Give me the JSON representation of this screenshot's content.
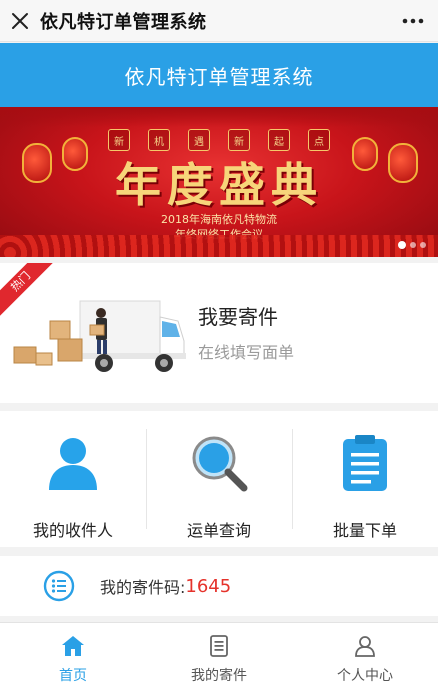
{
  "window": {
    "title": "依凡特订单管理系统",
    "close_icon": "close-icon",
    "more_icon": "more-icon"
  },
  "header": {
    "title": "依凡特订单管理系统",
    "color": "#2aa0e6"
  },
  "banner": {
    "chips": [
      "新",
      "机",
      "遇",
      "新",
      "起",
      "点"
    ],
    "main_text": "年度盛典",
    "subtitle_line1": "2018年海南依凡特物流",
    "subtitle_line2": "年终网络工作会议",
    "active_slide": 1,
    "slide_count": 3
  },
  "send_card": {
    "ribbon": "热门",
    "title": "我要寄件",
    "subtitle": "在线填写面单",
    "ribbon_color": "#e0282e"
  },
  "grid": [
    {
      "label": "我的收件人",
      "icon": "person-icon"
    },
    {
      "label": "运单查询",
      "icon": "magnifier-icon"
    },
    {
      "label": "批量下单",
      "icon": "clipboard-icon"
    }
  ],
  "code_row": {
    "label": "我的寄件码:",
    "value": "1645",
    "icon": "list-icon",
    "value_color": "#e5322b"
  },
  "tabbar": {
    "active": 0,
    "tabs": [
      {
        "label": "首页",
        "icon": "home-icon"
      },
      {
        "label": "我的寄件",
        "icon": "document-icon"
      },
      {
        "label": "个人中心",
        "icon": "user-icon"
      }
    ]
  }
}
